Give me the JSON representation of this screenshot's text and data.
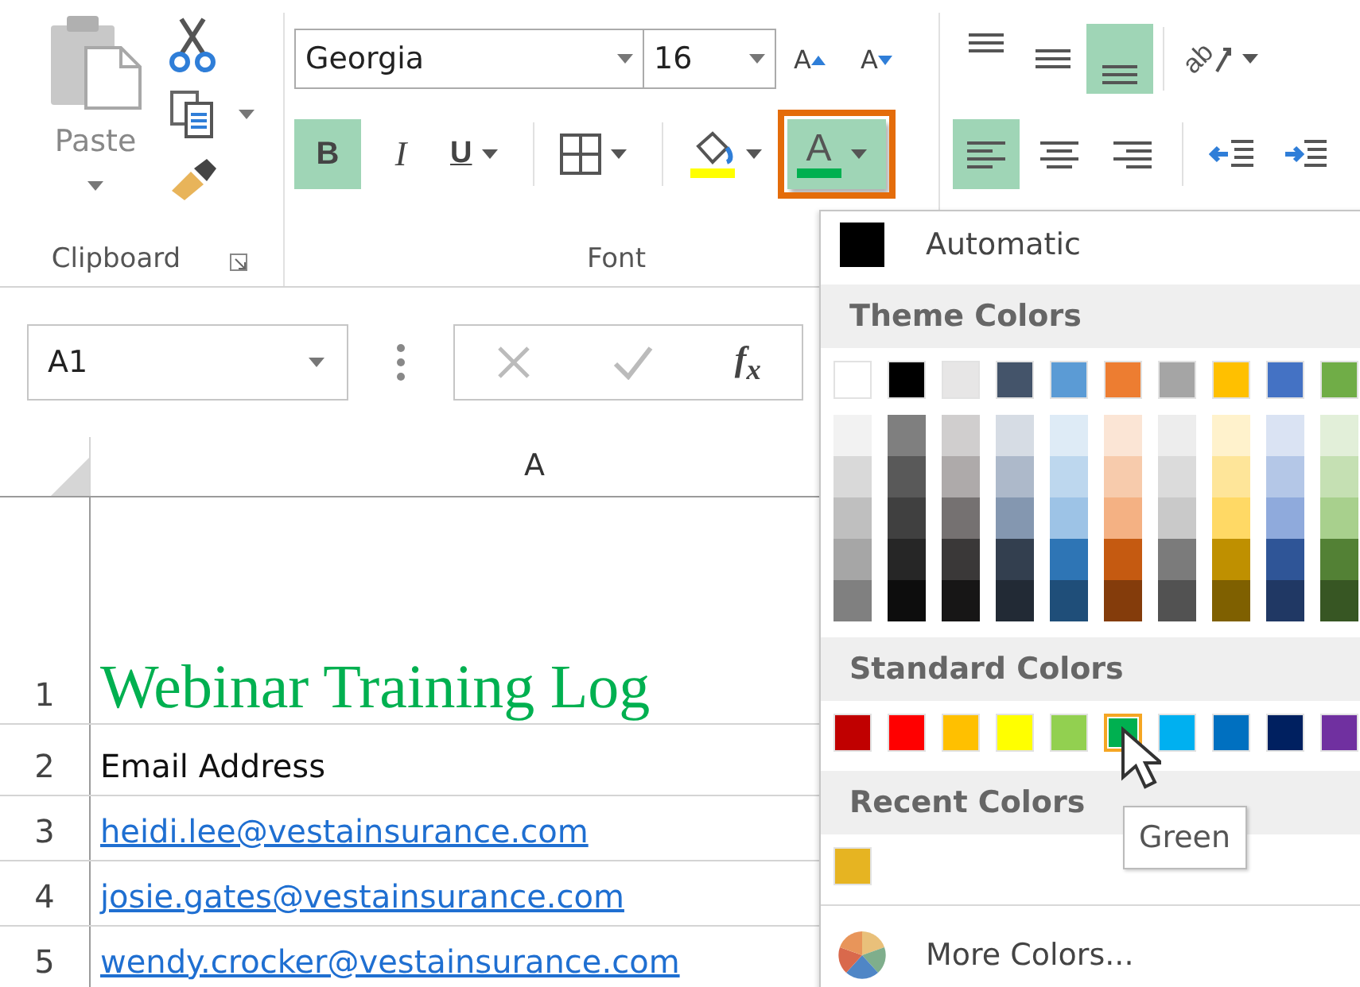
{
  "ribbon": {
    "clipboard": {
      "paste": "Paste",
      "label": "Clipboard"
    },
    "font": {
      "font_name": "Georgia",
      "font_size": "16",
      "grow_label": "A",
      "shrink_label": "A",
      "label": "Font",
      "buttons": [
        {
          "kind": "bold",
          "label": "B",
          "on": true,
          "dropdown": false
        },
        {
          "kind": "italic",
          "label": "I",
          "on": false,
          "dropdown": false
        },
        {
          "kind": "underline",
          "label": "U",
          "on": false,
          "dropdown": true
        },
        {
          "kind": "borders",
          "on": false,
          "dropdown": true
        },
        {
          "kind": "fill_color",
          "on": false,
          "dropdown": true,
          "color": "#ffff00"
        },
        {
          "kind": "font_color",
          "label": "A",
          "on": true,
          "dropdown": true,
          "open": true,
          "color": "#00b050"
        }
      ]
    },
    "alignment": {
      "orientation": "ab",
      "vertical": [
        {
          "kind": "top",
          "on": false
        },
        {
          "kind": "middle",
          "on": false
        },
        {
          "kind": "bottom",
          "on": true
        }
      ],
      "horizontal": [
        {
          "kind": "left",
          "on": true
        },
        {
          "kind": "center",
          "on": false
        },
        {
          "kind": "right",
          "on": false
        }
      ],
      "indent": [
        {
          "kind": "decrease"
        },
        {
          "kind": "increase"
        }
      ]
    }
  },
  "formula_bar": {
    "name_box": "A1",
    "function_label": "f$_{x}$"
  },
  "sheet": {
    "columns": [
      "A"
    ],
    "rows": [
      {
        "number": "1",
        "kind": "title",
        "value": "Webinar Training Log"
      },
      {
        "number": "2",
        "kind": "text",
        "value": "Email Address"
      },
      {
        "number": "3",
        "kind": "link",
        "value": "heidi.lee@vestainsurance.com"
      },
      {
        "number": "4",
        "kind": "link",
        "value": "josie.gates@vestainsurance.com"
      },
      {
        "number": "5",
        "kind": "link",
        "value": "wendy.crocker@vestainsurance.com"
      }
    ]
  },
  "color_menu": {
    "automatic": "Automatic",
    "theme_title": "Theme Colors",
    "theme_top": [
      {
        "color": "#ffffff",
        "selected": false
      },
      {
        "color": "#000000",
        "selected": false
      },
      {
        "color": "#e7e6e6",
        "selected": false
      },
      {
        "color": "#44546a",
        "selected": false
      },
      {
        "color": "#5b9bd5",
        "selected": false
      },
      {
        "color": "#ed7d31",
        "selected": false
      },
      {
        "color": "#a5a5a5",
        "selected": false
      },
      {
        "color": "#ffc000",
        "selected": false
      },
      {
        "color": "#4472c4",
        "selected": false
      },
      {
        "color": "#70ad47",
        "selected": false
      }
    ],
    "shade_columns": [
      {
        "swatches": [
          {
            "color": "#f2f2f2",
            "selected": false
          },
          {
            "color": "#d9d9d9",
            "selected": false
          },
          {
            "color": "#bfbfbf",
            "selected": false
          },
          {
            "color": "#a6a6a6",
            "selected": false
          },
          {
            "color": "#808080",
            "selected": false
          }
        ]
      },
      {
        "swatches": [
          {
            "color": "#7f7f7f",
            "selected": false
          },
          {
            "color": "#595959",
            "selected": false
          },
          {
            "color": "#404040",
            "selected": false
          },
          {
            "color": "#262626",
            "selected": false
          },
          {
            "color": "#0d0d0d",
            "selected": false
          }
        ]
      },
      {
        "swatches": [
          {
            "color": "#d0cece",
            "selected": false
          },
          {
            "color": "#aeaaaa",
            "selected": false
          },
          {
            "color": "#757171",
            "selected": false
          },
          {
            "color": "#3a3838",
            "selected": false
          },
          {
            "color": "#171616",
            "selected": false
          }
        ]
      },
      {
        "swatches": [
          {
            "color": "#d6dce4",
            "selected": false
          },
          {
            "color": "#adb9ca",
            "selected": false
          },
          {
            "color": "#8497b0",
            "selected": false
          },
          {
            "color": "#333f4f",
            "selected": false
          },
          {
            "color": "#222a35",
            "selected": false
          }
        ]
      },
      {
        "swatches": [
          {
            "color": "#deebf6",
            "selected": false
          },
          {
            "color": "#bdd7ee",
            "selected": false
          },
          {
            "color": "#9dc3e6",
            "selected": false
          },
          {
            "color": "#2e75b5",
            "selected": false
          },
          {
            "color": "#1f4e79",
            "selected": false
          }
        ]
      },
      {
        "swatches": [
          {
            "color": "#fbe5d5",
            "selected": false
          },
          {
            "color": "#f7cbac",
            "selected": false
          },
          {
            "color": "#f4b183",
            "selected": false
          },
          {
            "color": "#c55a11",
            "selected": false
          },
          {
            "color": "#843c0b",
            "selected": false
          }
        ]
      },
      {
        "swatches": [
          {
            "color": "#ededed",
            "selected": false
          },
          {
            "color": "#dbdbdb",
            "selected": false
          },
          {
            "color": "#c9c9c9",
            "selected": false
          },
          {
            "color": "#7b7b7b",
            "selected": false
          },
          {
            "color": "#525252",
            "selected": false
          }
        ]
      },
      {
        "swatches": [
          {
            "color": "#fff2cc",
            "selected": false
          },
          {
            "color": "#fee599",
            "selected": false
          },
          {
            "color": "#ffd965",
            "selected": false
          },
          {
            "color": "#bf9000",
            "selected": false
          },
          {
            "color": "#7f6000",
            "selected": false
          }
        ]
      },
      {
        "swatches": [
          {
            "color": "#dae3f3",
            "selected": false
          },
          {
            "color": "#b4c7e7",
            "selected": false
          },
          {
            "color": "#8faadc",
            "selected": false
          },
          {
            "color": "#2f5597",
            "selected": false
          },
          {
            "color": "#203864",
            "selected": false
          }
        ]
      },
      {
        "swatches": [
          {
            "color": "#e2efd9",
            "selected": false
          },
          {
            "color": "#c5e0b3",
            "selected": false
          },
          {
            "color": "#a8d08d",
            "selected": false
          },
          {
            "color": "#538135",
            "selected": false
          },
          {
            "color": "#375623",
            "selected": false
          }
        ]
      }
    ],
    "standard_title": "Standard Colors",
    "standard": [
      {
        "color": "#c00000",
        "selected": false
      },
      {
        "color": "#ff0000",
        "selected": false
      },
      {
        "color": "#ffc000",
        "selected": false
      },
      {
        "color": "#ffff00",
        "selected": false
      },
      {
        "color": "#92d050",
        "selected": false
      },
      {
        "color": "#00b050",
        "selected": true
      },
      {
        "color": "#00b0f0",
        "selected": false
      },
      {
        "color": "#0070c0",
        "selected": false
      },
      {
        "color": "#002060",
        "selected": false
      },
      {
        "color": "#7030a0",
        "selected": false
      }
    ],
    "recent_title": "Recent Colors",
    "recent": [
      {
        "color": "#e6b422",
        "selected": false
      }
    ],
    "more": "More Colors...",
    "tooltip": "Green"
  }
}
